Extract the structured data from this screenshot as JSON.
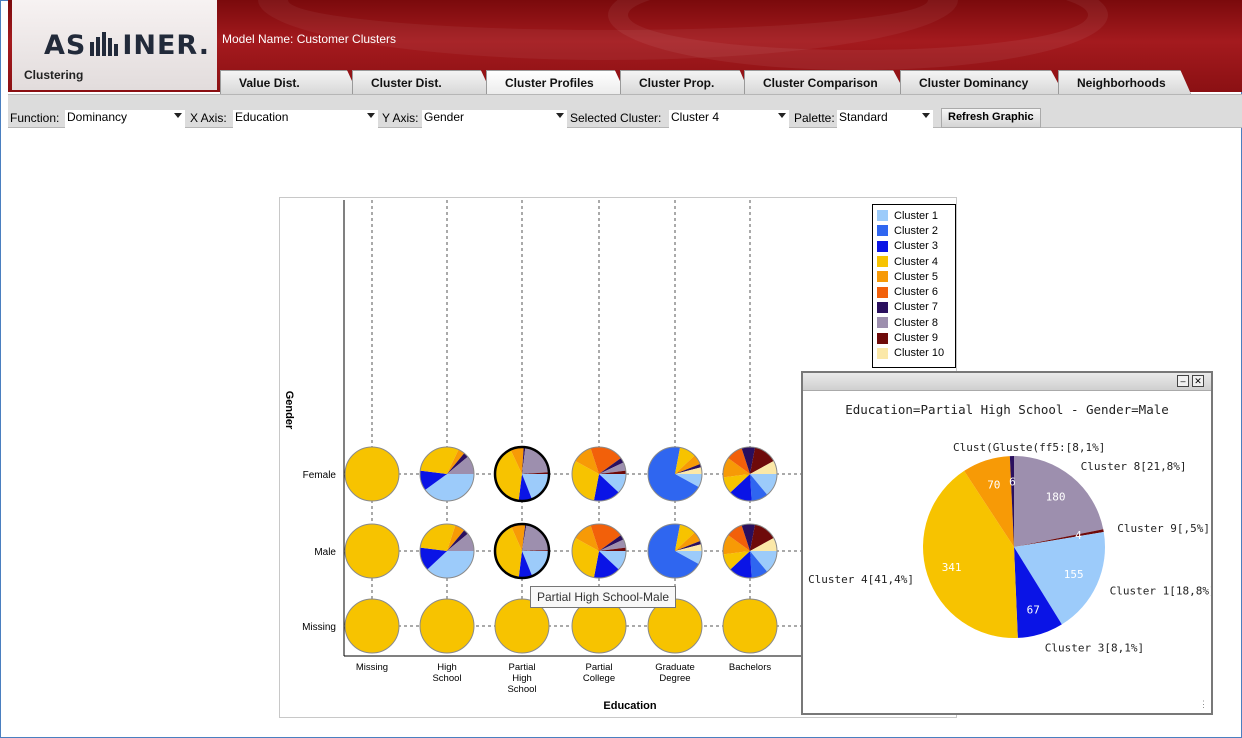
{
  "header": {
    "logo_text_left": "AS",
    "logo_text_right": "INER.",
    "model_name": "Model Name: Customer Clusters",
    "app_tab": "Clustering",
    "tabs": [
      {
        "label": "Value Dist.",
        "active": false
      },
      {
        "label": "Cluster Dist.",
        "active": false
      },
      {
        "label": "Cluster Profiles",
        "active": true
      },
      {
        "label": "Cluster Prop.",
        "active": false
      },
      {
        "label": "Cluster Comparison",
        "active": false
      },
      {
        "label": "Cluster Dominancy",
        "active": false
      },
      {
        "label": "Neighborhoods",
        "active": false
      }
    ]
  },
  "toolbar": {
    "function_label": "Function:",
    "function_value": "Dominancy",
    "xaxis_label": "X Axis:",
    "xaxis_value": "Education",
    "yaxis_label": "Y Axis:",
    "yaxis_value": "Gender",
    "cluster_label": "Selected Cluster:",
    "cluster_value": "Cluster 4",
    "palette_label": "Palette:",
    "palette_value": "Standard",
    "refresh_label": "Refresh Graphic"
  },
  "legend": [
    {
      "label": "Cluster 1",
      "color": "#9ccbfa"
    },
    {
      "label": "Cluster 2",
      "color": "#2f66f0"
    },
    {
      "label": "Cluster 3",
      "color": "#0a14e6"
    },
    {
      "label": "Cluster 4",
      "color": "#f7c300"
    },
    {
      "label": "Cluster 5",
      "color": "#f79a06"
    },
    {
      "label": "Cluster 6",
      "color": "#f2600a"
    },
    {
      "label": "Cluster 7",
      "color": "#2a0f5e"
    },
    {
      "label": "Cluster 8",
      "color": "#9d8fae"
    },
    {
      "label": "Cluster 9",
      "color": "#6e0a0a"
    },
    {
      "label": "Cluster 10",
      "color": "#fbe8a8"
    }
  ],
  "chart_data": {
    "type": "pie-grid",
    "xlabel": "Education",
    "ylabel": "Gender",
    "x_categories": [
      "Missing",
      "High School",
      "Partial High School",
      "Partial College",
      "Graduate Degree",
      "Bachelors"
    ],
    "y_categories": [
      "Female",
      "Male",
      "Missing"
    ],
    "highlighted_column": "Partial High School",
    "cells": [
      {
        "x": "Missing",
        "y": "Female",
        "shares": {
          "Cluster 4": 100
        }
      },
      {
        "x": "High School",
        "y": "Female",
        "shares": {
          "Cluster 1": 40,
          "Cluster 3": 12,
          "Cluster 4": 30,
          "Cluster 5": 4,
          "Cluster 7": 3,
          "Cluster 8": 11
        }
      },
      {
        "x": "Partial High School",
        "y": "Female",
        "shares": {
          "Cluster 1": 19,
          "Cluster 3": 8,
          "Cluster 4": 41,
          "Cluster 5": 8,
          "Cluster 7": 1,
          "Cluster 8": 22,
          "Cluster 9": 1
        }
      },
      {
        "x": "Partial College",
        "y": "Female",
        "shares": {
          "Cluster 1": 12,
          "Cluster 3": 16,
          "Cluster 4": 30,
          "Cluster 5": 12,
          "Cluster 6": 20,
          "Cluster 7": 3,
          "Cluster 8": 5,
          "Cluster 9": 2
        }
      },
      {
        "x": "Graduate Degree",
        "y": "Female",
        "shares": {
          "Cluster 1": 8,
          "Cluster 2": 70,
          "Cluster 4": 10,
          "Cluster 5": 6,
          "Cluster 7": 2,
          "Cluster 10": 4
        }
      },
      {
        "x": "Bachelors",
        "y": "Female",
        "shares": {
          "Cluster 1": 14,
          "Cluster 2": 10,
          "Cluster 3": 14,
          "Cluster 4": 10,
          "Cluster 5": 12,
          "Cluster 6": 10,
          "Cluster 7": 8,
          "Cluster 9": 14,
          "Cluster 10": 8
        }
      },
      {
        "x": "Missing",
        "y": "Male",
        "shares": {
          "Cluster 4": 100
        }
      },
      {
        "x": "High School",
        "y": "Male",
        "shares": {
          "Cluster 1": 38,
          "Cluster 3": 14,
          "Cluster 4": 28,
          "Cluster 5": 6,
          "Cluster 7": 3,
          "Cluster 8": 11
        }
      },
      {
        "x": "Partial High School",
        "y": "Male",
        "shares": {
          "Cluster 1": 18.8,
          "Cluster 3": 8.1,
          "Cluster 4": 41.4,
          "Cluster 5": 8.5,
          "Cluster 7": 0.7,
          "Cluster 8": 21.8,
          "Cluster 9": 0.5
        }
      },
      {
        "x": "Partial College",
        "y": "Male",
        "shares": {
          "Cluster 1": 12,
          "Cluster 3": 16,
          "Cluster 4": 30,
          "Cluster 5": 12,
          "Cluster 6": 20,
          "Cluster 7": 3,
          "Cluster 8": 5,
          "Cluster 9": 2
        }
      },
      {
        "x": "Graduate Degree",
        "y": "Male",
        "shares": {
          "Cluster 1": 8,
          "Cluster 2": 70,
          "Cluster 4": 10,
          "Cluster 5": 6,
          "Cluster 7": 2,
          "Cluster 10": 4
        }
      },
      {
        "x": "Bachelors",
        "y": "Male",
        "shares": {
          "Cluster 1": 14,
          "Cluster 2": 10,
          "Cluster 3": 14,
          "Cluster 4": 10,
          "Cluster 5": 12,
          "Cluster 6": 10,
          "Cluster 7": 8,
          "Cluster 9": 14,
          "Cluster 10": 8
        }
      },
      {
        "x": "Missing",
        "y": "Missing",
        "shares": {
          "Cluster 4": 100
        }
      },
      {
        "x": "High School",
        "y": "Missing",
        "shares": {
          "Cluster 4": 100
        }
      },
      {
        "x": "Partial High School",
        "y": "Missing",
        "shares": {
          "Cluster 4": 100
        }
      },
      {
        "x": "Partial College",
        "y": "Missing",
        "shares": {
          "Cluster 4": 100
        }
      },
      {
        "x": "Graduate Degree",
        "y": "Missing",
        "shares": {
          "Cluster 4": 100
        }
      },
      {
        "x": "Bachelors",
        "y": "Missing",
        "shares": {
          "Cluster 4": 100
        }
      }
    ]
  },
  "tooltip": "Partial High School-Male",
  "popup": {
    "title": "Education=Partial High School - Gender=Male",
    "chart_data": {
      "type": "pie",
      "slices": [
        {
          "cluster": "Cluster 1",
          "count": 155,
          "label": "Cluster 1[18,8%]"
        },
        {
          "cluster": "Cluster 3",
          "count": 67,
          "label": "Cluster 3[8,1%]"
        },
        {
          "cluster": "Cluster 4",
          "count": 341,
          "label": "Cluster 4[41,4%]"
        },
        {
          "cluster": "Cluster 5",
          "count": 70,
          "label": ""
        },
        {
          "cluster": "Cluster 7",
          "count": 6,
          "label": ""
        },
        {
          "cluster": "Cluster 8",
          "count": 180,
          "label": "Cluster 8[21,8%]"
        },
        {
          "cluster": "Cluster 9",
          "count": 4,
          "label": "Cluster 9[,5%]"
        }
      ],
      "overlap_label": "Clust(Gluste(ff5:[8,1%]"
    }
  }
}
